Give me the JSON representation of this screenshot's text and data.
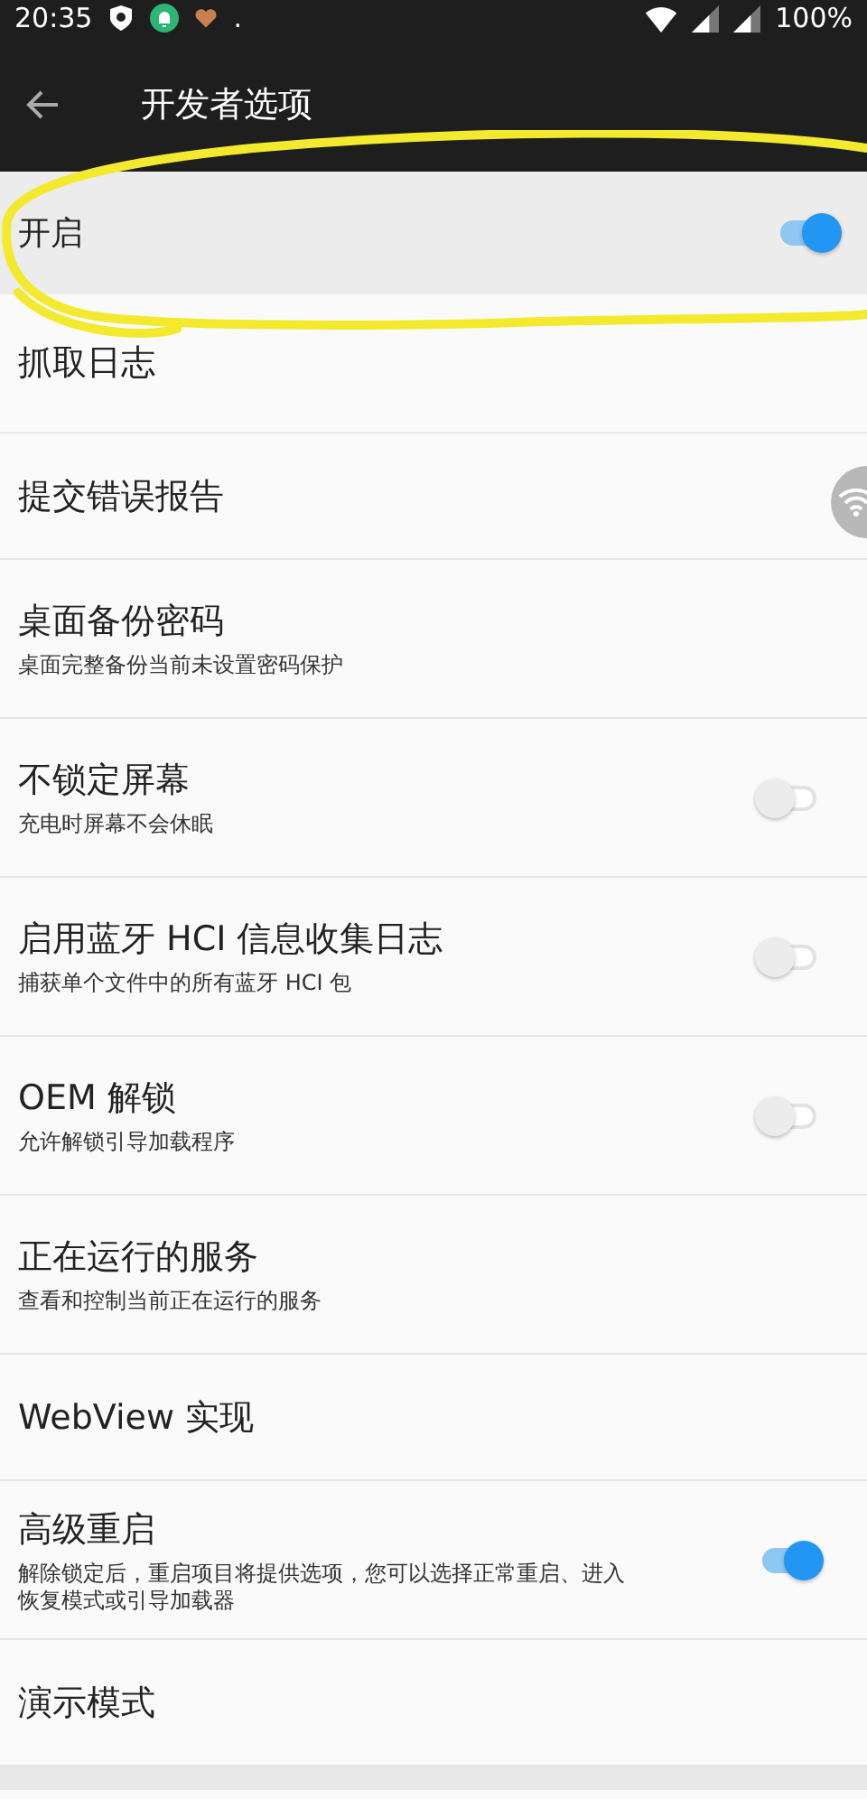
{
  "status_bar": {
    "time": "20:35",
    "dot": ".",
    "battery": "100%"
  },
  "toolbar": {
    "title": "开发者选项"
  },
  "master_switch": {
    "label": "开启",
    "on": true
  },
  "rows": [
    {
      "kind": "plain",
      "title": "抓取日志"
    },
    {
      "kind": "plain",
      "title": "提交错误报告"
    },
    {
      "kind": "plain",
      "title": "桌面备份密码",
      "summary": "桌面完整备份当前未设置密码保护"
    },
    {
      "kind": "switch",
      "title": "不锁定屏幕",
      "summary": "充电时屏幕不会休眠",
      "on": false
    },
    {
      "kind": "switch",
      "title": "启用蓝牙 HCI 信息收集日志",
      "summary": "捕获单个文件中的所有蓝牙 HCI 包",
      "on": false
    },
    {
      "kind": "switch",
      "title": "OEM 解锁",
      "summary": "允许解锁引导加载程序",
      "on": false
    },
    {
      "kind": "plain",
      "title": "正在运行的服务",
      "summary": "查看和控制当前正在运行的服务"
    },
    {
      "kind": "plain",
      "title": "WebView 实现"
    },
    {
      "kind": "switch",
      "title": "高级重启",
      "summary": "解除锁定后，重启项目将提供选项，您可以选择正常重启、进入恢复模式或引导加载器",
      "on": true
    },
    {
      "kind": "plain",
      "title": "演示模式"
    }
  ]
}
